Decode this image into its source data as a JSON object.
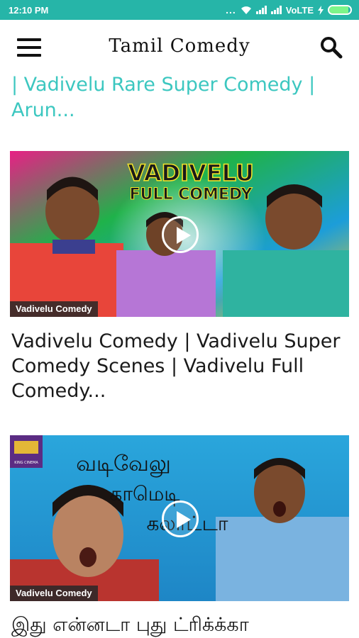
{
  "status_bar": {
    "time": "12:10 PM",
    "dots": "...",
    "network_label": "VoLTE",
    "icons": [
      "wifi-icon",
      "signal-icon",
      "signal-icon",
      "charging-icon",
      "battery-icon"
    ],
    "battery_level": 0.9
  },
  "app_bar": {
    "title": "Tamil Comedy",
    "menu_icon": "hamburger-menu-icon",
    "search_icon": "search-icon"
  },
  "colors": {
    "status_bar_bg": "#26b5a8",
    "accent_title": "#3cc7c0",
    "text": "#1a1a1a"
  },
  "feed": {
    "partial_title": "| Vadivelu Rare Super Comedy | Arun...",
    "cards": [
      {
        "thumbnail_text_line1": "VADIVELU",
        "thumbnail_text_line2": "FULL COMEDY",
        "channel": "Vadivelu Comedy",
        "title": "Vadivelu Comedy | Vadivelu Super Comedy Scenes | Vadivelu Full Comedy..."
      },
      {
        "logo_text": "KING CINEMA",
        "thumbnail_text_line1": "வடிவேலு",
        "thumbnail_text_line2": "காமெடி",
        "thumbnail_text_line3": "கலாட்டா",
        "channel": "Vadivelu Comedy",
        "title": "இது என்னடா புது ட்ரிக்க்கா"
      }
    ]
  }
}
